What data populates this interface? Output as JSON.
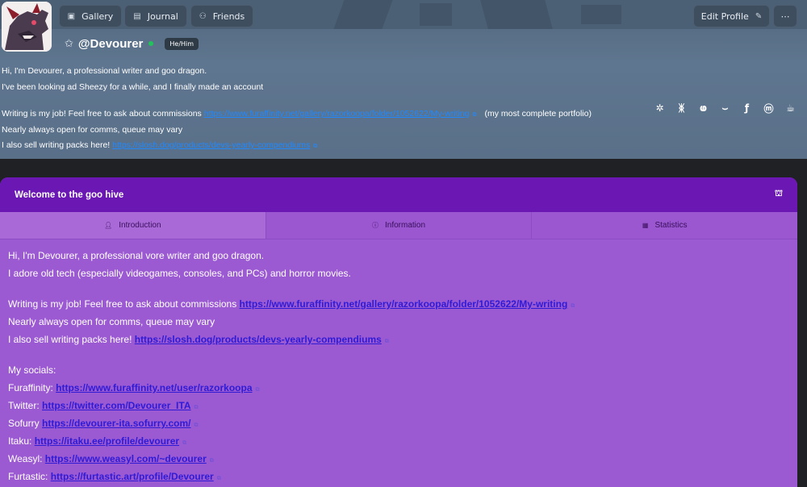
{
  "nav": {
    "gallery": "Gallery",
    "journal": "Journal",
    "friends": "Friends",
    "edit_profile": "Edit Profile",
    "more": "⋯"
  },
  "profile": {
    "username": "@Devourer",
    "pronouns": "He/Him"
  },
  "bio": {
    "line1": "Hi, I'm Devourer, a professional writer and goo dragon.",
    "line2": "I've been looking ad Sheezy for a while, and I finally made an account",
    "line3_text": "Writing is my job! Feel free to ask about commissions ",
    "line3_link": "https://www.furaffinity.net/gallery/razorkoopa/folder/1052622/My-writing",
    "line3_suffix": "(my most complete portfolio)",
    "line4": "Nearly always open for comms, queue may vary",
    "line5_text": "I also sell writing packs here! ",
    "line5_link": "https://slosh.dog/products/devs-yearly-compendiums"
  },
  "socials": [
    "gear-social-icon",
    "butterfly-icon",
    "itaku-icon",
    "weasyl-icon",
    "furaffinity-icon",
    "mastodon-icon",
    "kofi-icon"
  ],
  "panel": {
    "title": "Welcome to the goo hive",
    "tabs": [
      {
        "label": "Introduction"
      },
      {
        "label": "Information"
      },
      {
        "label": "Statistics"
      }
    ],
    "intro": {
      "l1": "Hi, I'm Devourer, a professional vore writer and goo dragon.",
      "l2": "I adore old tech (especially videogames, consoles, and PCs) and horror movies.",
      "l3_text": "Writing is my job! Feel free to ask about commissions ",
      "l3_link": "https://www.furaffinity.net/gallery/razorkoopa/folder/1052622/My-writing",
      "l4": "Nearly always open for comms, queue may vary",
      "l5_text": "I also sell writing packs here! ",
      "l5_link": "https://slosh.dog/products/devs-yearly-compendiums",
      "socials_heading": "My socials:",
      "social_links": [
        {
          "label": "Furaffinity: ",
          "url": "https://www.furaffinity.net/user/razorkoopa"
        },
        {
          "label": "Twitter: ",
          "url": "https://twitter.com/Devourer_ITA"
        },
        {
          "label": "Sofurry ",
          "url": "https://devourer-ita.sofurry.com/"
        },
        {
          "label": "Itaku: ",
          "url": "https://itaku.ee/profile/devourer"
        },
        {
          "label": "Weasyl: ",
          "url": "https://www.weasyl.com/~devourer"
        },
        {
          "label": "Furtastic: ",
          "url": "https://furtastic.art/profile/Devourer"
        }
      ]
    }
  }
}
